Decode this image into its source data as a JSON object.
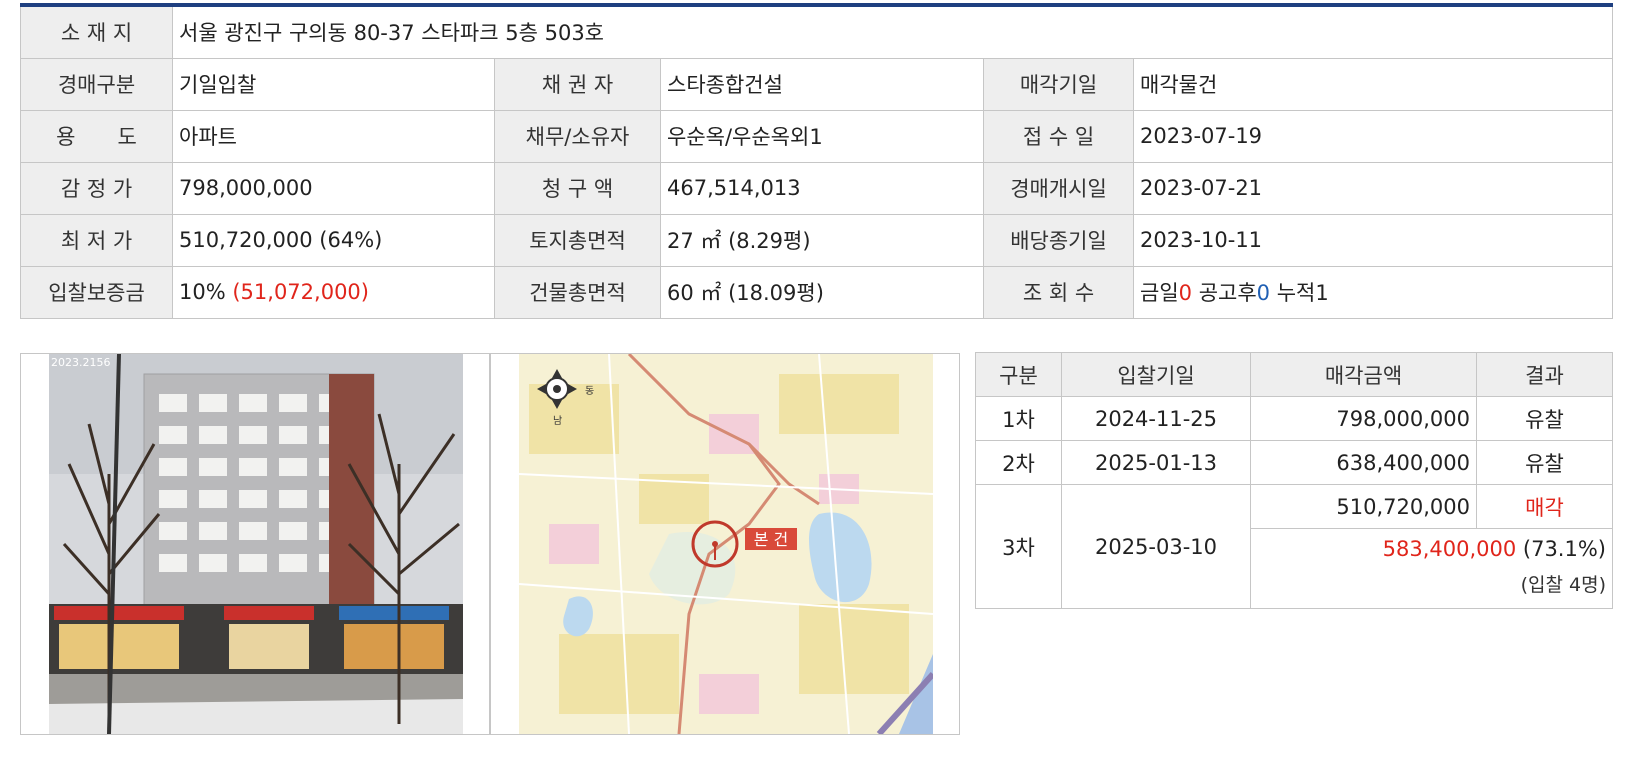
{
  "info": {
    "location_label": "소 재 지",
    "location_value": "서울 광진구 구의동 80-37 스타파크 5층 503호",
    "auction_type_label": "경매구분",
    "auction_type_value": "기일입찰",
    "creditor_label": "채 권 자",
    "creditor_value": "스타종합건설",
    "sale_date_label": "매각기일",
    "sale_date_value": "매각물건",
    "usage_label": "용　　도",
    "usage_value": "아파트",
    "debtor_label": "채무/소유자",
    "debtor_value": "우순옥/우순옥외1",
    "receipt_date_label": "접 수 일",
    "receipt_date_value": "2023-07-19",
    "appraisal_label": "감 정 가",
    "appraisal_value": "798,000,000",
    "claim_label": "청 구 액",
    "claim_value": "467,514,013",
    "start_date_label": "경매개시일",
    "start_date_value": "2023-07-21",
    "min_price_label": "최 저 가",
    "min_price_value": "510,720,000 (64%)",
    "land_area_label": "토지총면적",
    "land_area_value": "27 ㎡ (8.29평)",
    "dividend_date_label": "배당종기일",
    "dividend_date_value": "2023-10-11",
    "deposit_label": "입찰보증금",
    "deposit_prefix": "10% ",
    "deposit_amount": "(51,072,000)",
    "building_area_label": "건물총면적",
    "building_area_value": "60 ㎡ (18.09평)",
    "views_label": "조 회 수",
    "views_today_label": "금일",
    "views_today_value": "0",
    "views_after_label": " 공고후",
    "views_after_value": "0",
    "views_total_label": " 누적",
    "views_total_value": "1"
  },
  "photos": {
    "street_view_stamp": "2023.2156",
    "map_marker_label": "본 건",
    "map_compass_east": "동",
    "map_compass_south": "남"
  },
  "bids": {
    "headers": [
      "구분",
      "입찰기일",
      "매각금액",
      "결과"
    ],
    "rows": [
      {
        "round": "1차",
        "date": "2024-11-25",
        "amount": "798,000,000",
        "result": "유찰"
      },
      {
        "round": "2차",
        "date": "2025-01-13",
        "amount": "638,400,000",
        "result": "유찰"
      },
      {
        "round": "3차",
        "date": "2025-03-10",
        "amount": "510,720,000",
        "result": "매각",
        "winning_amount": "583,400,000",
        "winning_rate": " (73.1%)",
        "bidders": "(입찰 4명)"
      }
    ]
  },
  "colors": {
    "accent_border": "#1e3f80",
    "highlight_red": "#e0251b",
    "highlight_blue": "#1f5fb4",
    "header_bg": "#eeeeee",
    "border": "#c6c6c6"
  }
}
